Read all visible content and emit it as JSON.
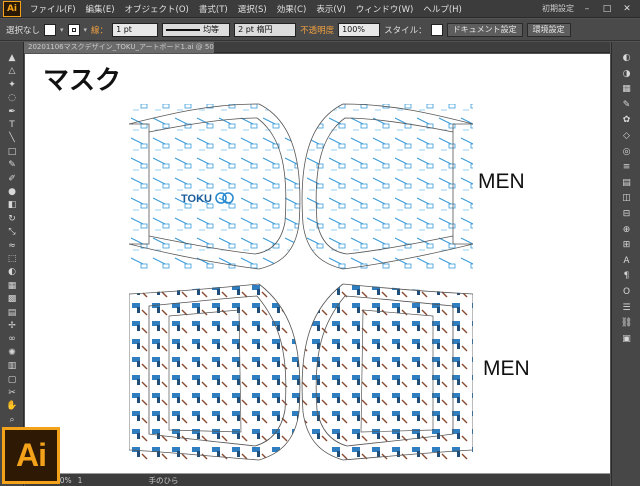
{
  "app": {
    "logo": "Ai"
  },
  "menubar": {
    "items": [
      "ファイル(F)",
      "編集(E)",
      "オブジェクト(O)",
      "書式(T)",
      "選択(S)",
      "効果(C)",
      "表示(V)",
      "ウィンドウ(W)",
      "ヘルプ(H)"
    ],
    "workspace": "初期設定",
    "window_buttons": [
      "–",
      "□",
      "✕"
    ]
  },
  "control_bar": {
    "selection": "選択なし",
    "stroke_label": "線：",
    "stroke_value": "1 pt",
    "profile_label": "均等",
    "brush_label": "2 pt 楕円",
    "opacity_label": "不透明度",
    "opacity_value": "100%",
    "style_label": "スタイル：",
    "doc_setup_button": "ドキュメント設定",
    "prefs_button": "環境設定"
  },
  "document": {
    "tab_title": "20201106マスクデザイン_TOKU_アートボード1.ai @ 50% (RGB/プレビュー)"
  },
  "canvas": {
    "title": "マスク",
    "label_top": "MEN",
    "label_bottom": "MEN",
    "brand_text": "TOKU"
  },
  "status_bar": {
    "zoom": "50%",
    "artboard": "1",
    "tool": "手のひら"
  },
  "colors": {
    "accent": "#f4a21a",
    "pattern_blue": "#3a9bd8",
    "outline": "#555555"
  },
  "icons": {
    "tools": [
      "selection-icon",
      "direct-selection-icon",
      "magic-wand-icon",
      "lasso-icon",
      "pen-icon",
      "type-icon",
      "line-icon",
      "rectangle-icon",
      "paintbrush-icon",
      "pencil-icon",
      "blob-brush-icon",
      "eraser-icon",
      "rotate-icon",
      "scale-icon",
      "width-icon",
      "free-transform-icon",
      "shape-builder-icon",
      "perspective-icon",
      "mesh-icon",
      "gradient-icon",
      "eyedropper-icon",
      "blend-icon",
      "symbol-sprayer-icon",
      "graph-icon",
      "artboard-icon",
      "slice-icon",
      "hand-icon",
      "zoom-icon"
    ],
    "panels": [
      "color-icon",
      "color-guide-icon",
      "swatches-icon",
      "brushes-icon",
      "symbols-icon",
      "graphic-styles-icon",
      "appearance-icon",
      "stroke-icon",
      "gradient-panel-icon",
      "transparency-icon",
      "align-icon",
      "pathfinder-icon",
      "transform-icon",
      "character-icon",
      "paragraph-icon",
      "opentype-icon",
      "layers-icon",
      "links-icon",
      "artboards-icon"
    ]
  }
}
